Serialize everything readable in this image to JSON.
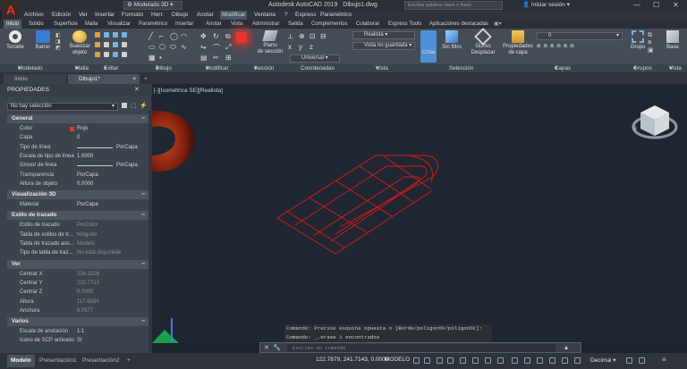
{
  "title_bar": {
    "app_title": "Autodesk AutoCAD 2019",
    "doc_title": "Dibujo1.dwg",
    "workspace": "Modelado 3D",
    "search_placeholder": "Escriba palabra clave o frase",
    "signin": "Iniciar sesión"
  },
  "menu": [
    "Archivo",
    "Edición",
    "Ver",
    "Insertar",
    "Formato",
    "Herr.",
    "Dibujo",
    "Acotar",
    "Modificar",
    "Ventana",
    "?",
    "Express",
    "Paramétrico"
  ],
  "ribbon_tabs": [
    "Inicio",
    "Sólido",
    "Superficie",
    "Malla",
    "Visualizar",
    "Paramétrico",
    "Insertar",
    "Anotar",
    "Vista",
    "Administrar",
    "Salida",
    "Complementos",
    "Colaborar",
    "Express Tools",
    "Aplicaciones destacadas"
  ],
  "ribbon": {
    "toroide": "Toroide",
    "barrer": "Barrer",
    "suavizar_objeto": [
      "Suavizar",
      "objeto"
    ],
    "plano_seccion": [
      "Plano",
      "de sección"
    ],
    "visual_style": "Realista",
    "named_view": "Vista no guardada",
    "ucs": "Universal",
    "criba": "Criba",
    "sin_filtro": "Sin filtro",
    "gizmo": [
      "Gizmo",
      "Desplazar"
    ],
    "propiedades_capa": [
      "Propiedades",
      "de capa"
    ],
    "layer_value": "0",
    "grupo": "Grupo",
    "base": "Base"
  },
  "panel_labels": [
    "Modelado",
    "Malla",
    "Editar sólidos",
    "Dibujo",
    "Modificar",
    "Sección",
    "Coordenadas",
    "Vista",
    "Selección",
    "Capas",
    "Grupos",
    "Vista"
  ],
  "doc_tabs": [
    "Inicio",
    "Dibujo1*"
  ],
  "properties": {
    "title": "PROPIEDADES",
    "selection": "No hay selección",
    "sections": [
      {
        "name": "General",
        "rows": [
          {
            "k": "Color",
            "v": "Rojo"
          },
          {
            "k": "Capa",
            "v": "0"
          },
          {
            "k": "Tipo de línea",
            "v": "PorCapa"
          },
          {
            "k": "Escala de tipo de línea",
            "v": "1.0000"
          },
          {
            "k": "Grosor de línea",
            "v": "PorCapa"
          },
          {
            "k": "Transparencia",
            "v": "PorCapa"
          },
          {
            "k": "Altura de objeto",
            "v": "0.0000"
          }
        ]
      },
      {
        "name": "Visualización 3D",
        "rows": [
          {
            "k": "Material",
            "v": "PorCapa"
          }
        ]
      },
      {
        "name": "Estilo de trazado",
        "rows": [
          {
            "k": "Estilo de trazado",
            "v": "PorColor"
          },
          {
            "k": "Tabla de estilos de tr...",
            "v": "Ninguno"
          },
          {
            "k": "Tabla de trazado aso...",
            "v": "Modelo"
          },
          {
            "k": "Tipo de tabla de traz...",
            "v": "No está disponible"
          }
        ]
      },
      {
        "name": "Ver",
        "rows": [
          {
            "k": "Centrar X",
            "v": "234.2226"
          },
          {
            "k": "Centrar Y",
            "v": "210.7713"
          },
          {
            "k": "Centrar Z",
            "v": "0.0000"
          },
          {
            "k": "Altura",
            "v": "117.6534"
          },
          {
            "k": "Anchura",
            "v": "8.0577"
          }
        ]
      },
      {
        "name": "Varios",
        "rows": [
          {
            "k": "Escala de anotación",
            "v": "1:1"
          },
          {
            "k": "Icono de SCP activado",
            "v": "Sí"
          }
        ]
      }
    ]
  },
  "viewport_label": "[-][Isométrica SE][Realista]",
  "command": {
    "history": [
      "Comando: Precise esquina opuesta o [Borde/poligonOV/poligonOC]:",
      "Comando: _.erase 1 encontrados"
    ],
    "placeholder": "Escriba un comando"
  },
  "status": {
    "layout_tabs": [
      "Modelo",
      "Presentación1",
      "Presentación2"
    ],
    "coords": "122.7879, 241.7143, 0.0000",
    "model": "MODELO",
    "units": "Decimal"
  },
  "colors": {
    "accent_red": "#e8342b",
    "geometry_red": "#d11a1a",
    "torus": "#8b2410",
    "viewport_bg": "#1f2631"
  }
}
